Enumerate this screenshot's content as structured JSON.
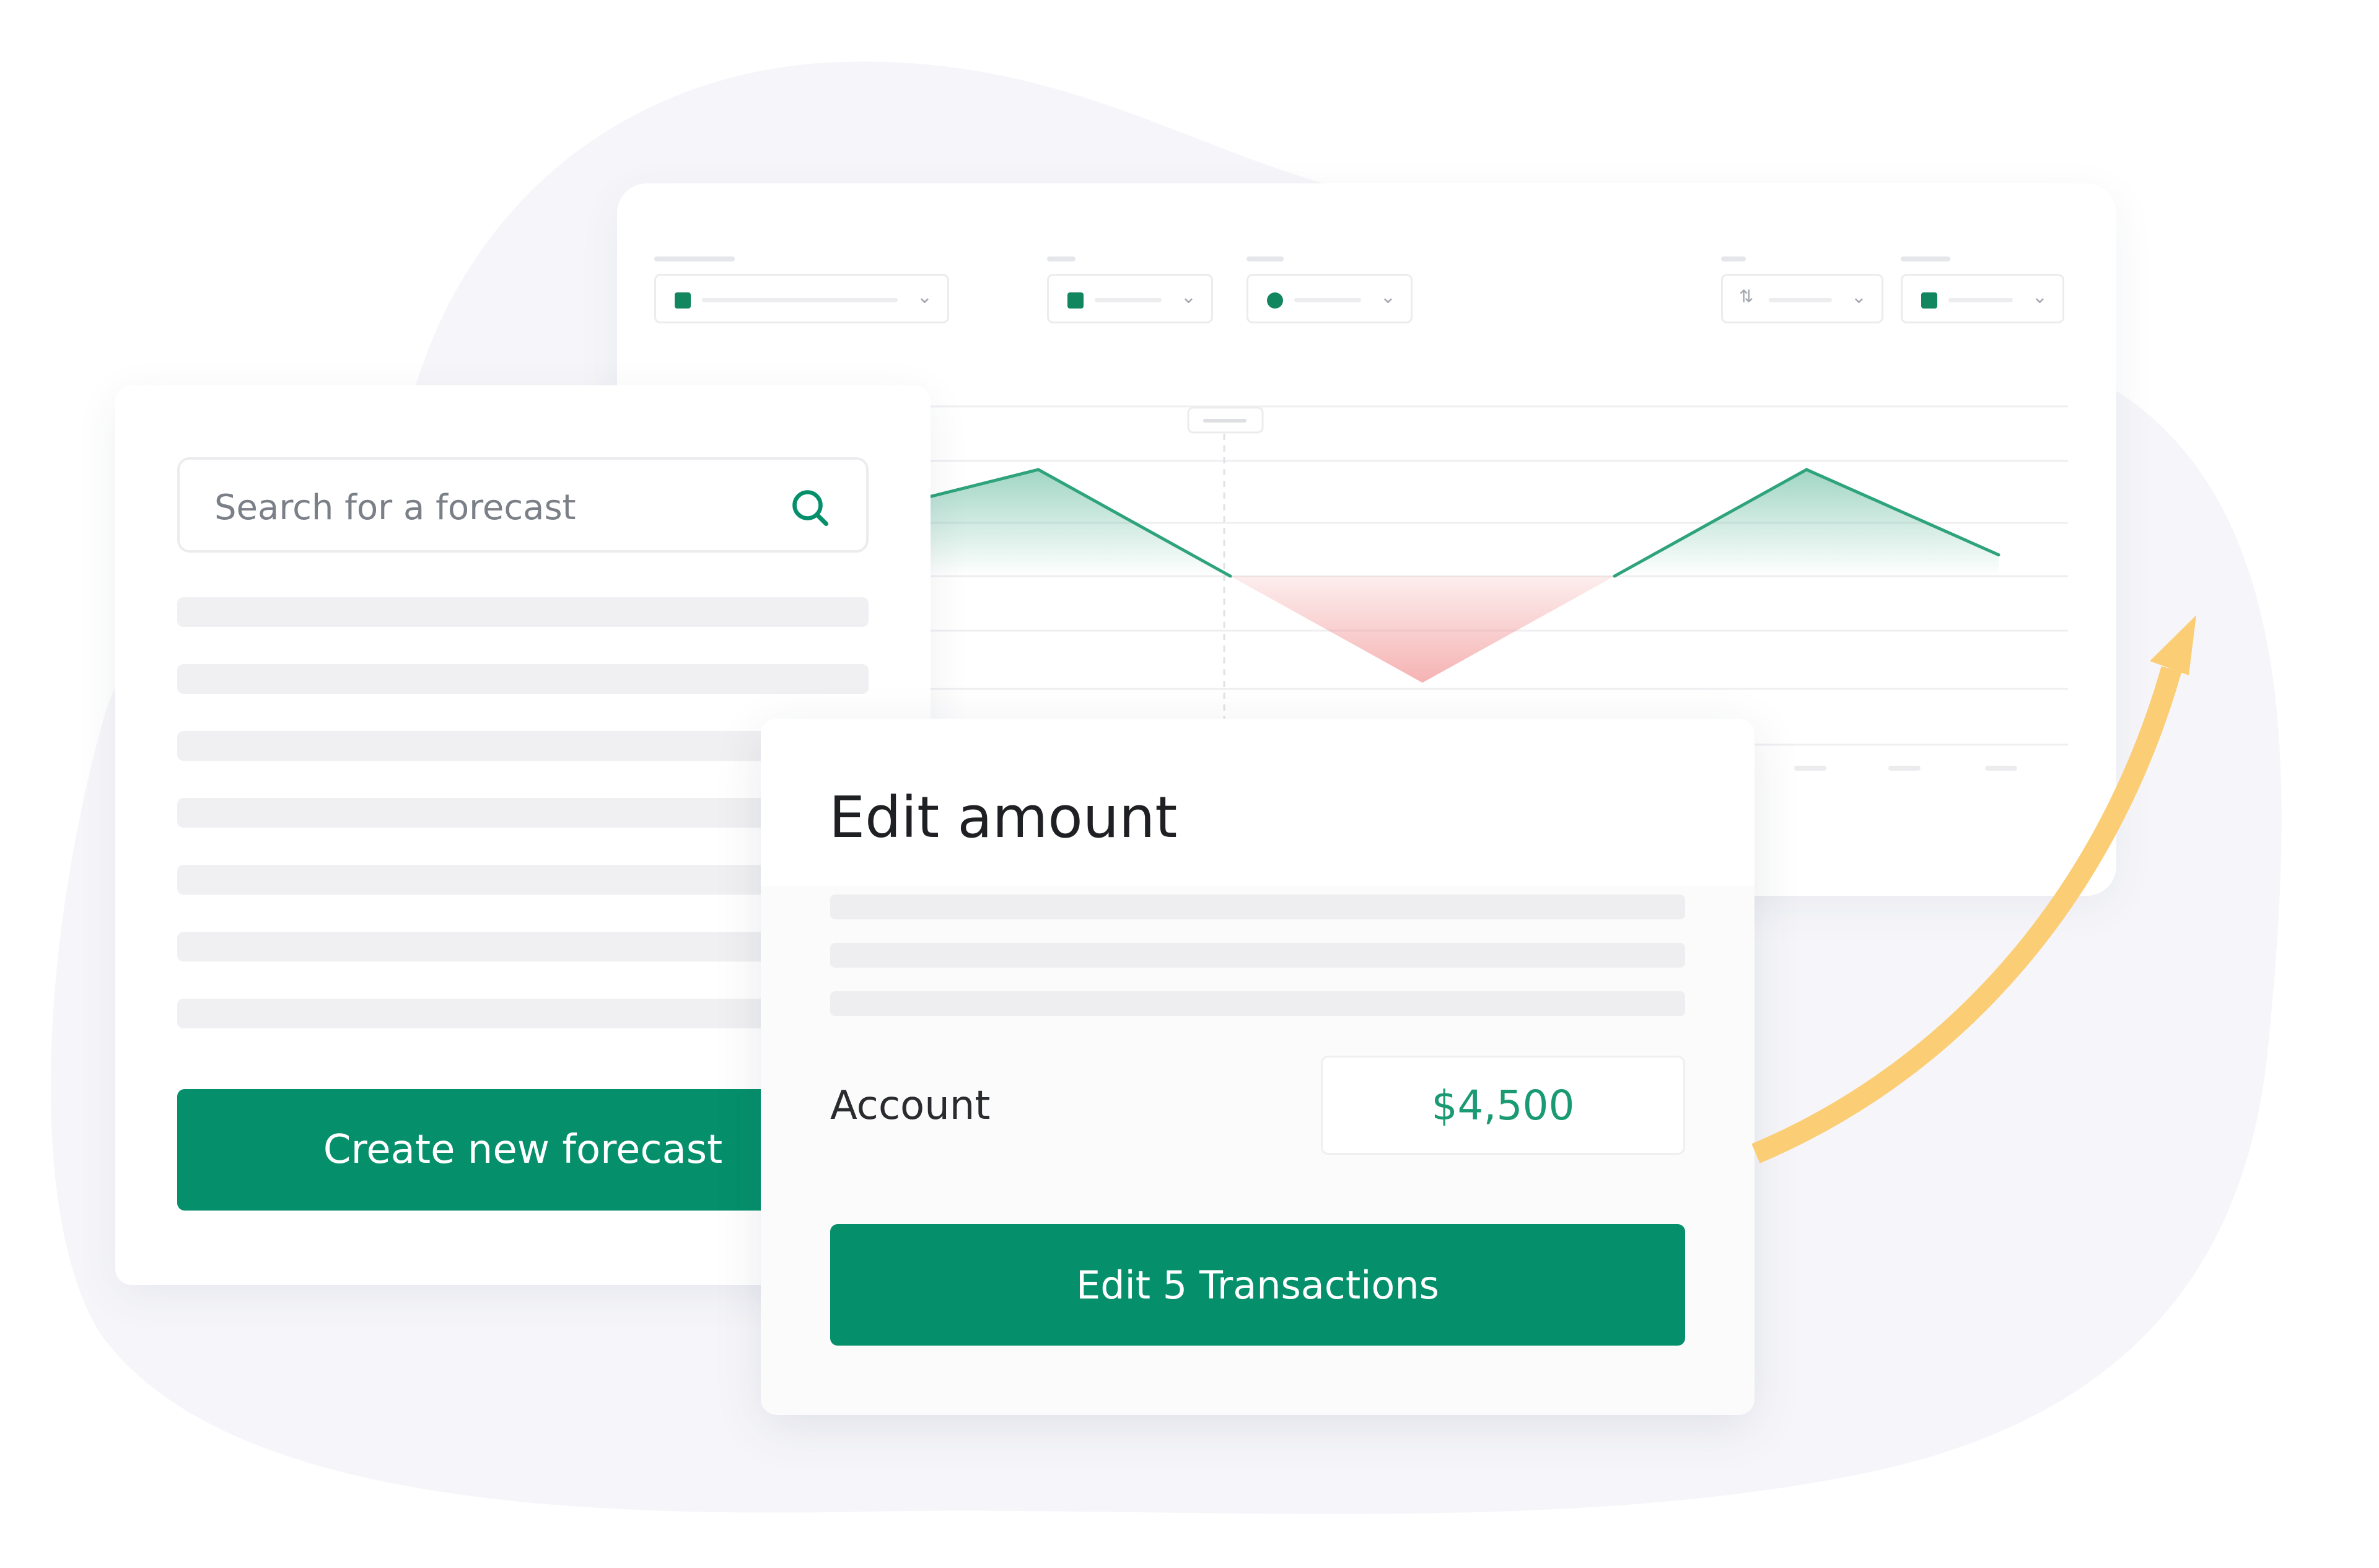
{
  "colors": {
    "primary": "#05906b",
    "chart_positive": "#2ea37c",
    "chart_negative": "#f08a8a",
    "arrow": "#fbcd74",
    "blob": "#f6f6fa"
  },
  "dashboard": {
    "controls": [
      {
        "icon": "calendar-icon"
      },
      {
        "icon": "document-icon"
      },
      {
        "icon": "pie-chart-icon"
      },
      {
        "icon": "sort-icon"
      },
      {
        "icon": "calendar-icon"
      }
    ]
  },
  "chart_data": {
    "type": "area",
    "x": [
      0,
      1,
      2,
      3,
      4,
      5,
      6
    ],
    "values": [
      0.55,
      1.0,
      0,
      -1.0,
      0,
      1.0,
      0.2
    ],
    "grid": true,
    "legend": "none"
  },
  "search_panel": {
    "search_placeholder": "Search for a forecast",
    "create_button": "Create new forecast"
  },
  "edit_modal": {
    "title": "Edit amount",
    "account_label": "Account",
    "amount": "$4,500",
    "submit_button": "Edit 5 Transactions"
  }
}
